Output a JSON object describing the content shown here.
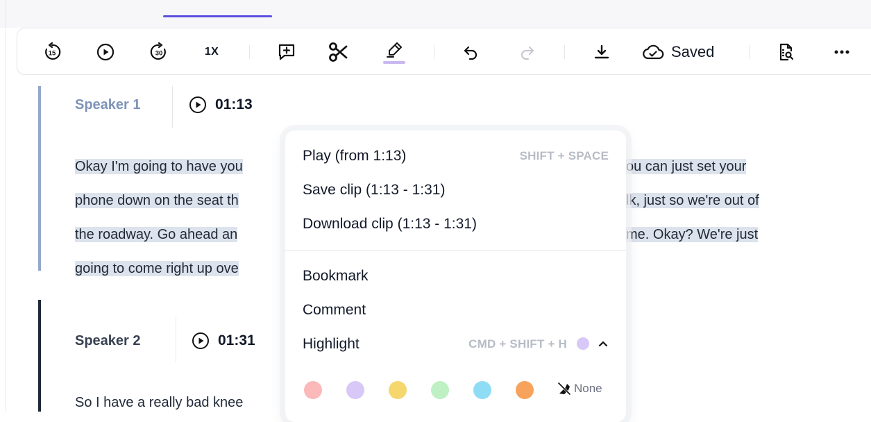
{
  "toolbar": {
    "skip_back_label": "15",
    "skip_forward_label": "30",
    "speed": "1X",
    "saved_label": "Saved",
    "highlight_underline_color": "#c9b8f0",
    "icons": [
      "rewind-15-icon",
      "play-icon",
      "forward-30-icon",
      "add-comment-icon",
      "scissors-icon",
      "highlighter-icon",
      "undo-icon",
      "redo-icon",
      "download-icon",
      "cloud-saved-icon",
      "transcript-search-icon",
      "more-icon"
    ]
  },
  "segments": [
    {
      "speaker": "Speaker 1",
      "time": "01:13",
      "accent": "#94a8c8",
      "lines": [
        {
          "left": "Okay I'm going to have you",
          "right": "ou can just set your"
        },
        {
          "left": "phone down on the seat th",
          "right": "lk, just so we're out of"
        },
        {
          "left": "the roadway. Go ahead an",
          "right": "me. Okay? We're just"
        },
        {
          "left": "going to come right up ove",
          "right": ""
        }
      ]
    },
    {
      "speaker": "Speaker 2",
      "time": "01:31",
      "accent": "#1f2937",
      "lines": [
        {
          "left": "So I have a really bad knee",
          "right": ""
        }
      ]
    }
  ],
  "menu": {
    "play": {
      "label": "Play (from 1:13)",
      "shortcut": "SHIFT + SPACE"
    },
    "save_clip": "Save clip (1:13 - 1:31)",
    "download_clip": "Download clip (1:13 - 1:31)",
    "bookmark": "Bookmark",
    "comment": "Comment",
    "highlight": {
      "label": "Highlight",
      "shortcut": "CMD + SHIFT + H",
      "current_color": "#d8c8f7"
    },
    "highlight_colors": [
      "#fbb9b9",
      "#d8c8f7",
      "#f5d76e",
      "#bff0c4",
      "#8fdcf5",
      "#f7a35c"
    ],
    "none_label": "None"
  }
}
